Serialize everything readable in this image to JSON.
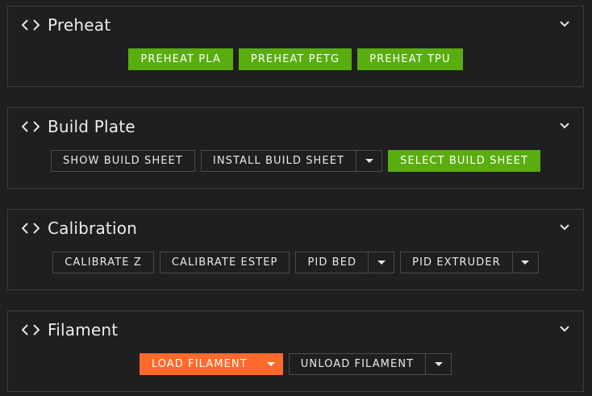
{
  "panels": {
    "preheat": {
      "title": "Preheat",
      "buttons": [
        "PREHEAT PLA",
        "PREHEAT PETG",
        "PREHEAT TPU"
      ]
    },
    "build_plate": {
      "title": "Build Plate",
      "show": "SHOW BUILD SHEET",
      "install": "INSTALL BUILD SHEET",
      "select": "SELECT BUILD SHEET"
    },
    "calibration": {
      "title": "Calibration",
      "calibrate_z": "CALIBRATE Z",
      "calibrate_estep": "CALIBRATE ESTEP",
      "pid_bed": "PID BED",
      "pid_extruder": "PID EXTRUDER"
    },
    "filament": {
      "title": "Filament",
      "load": "LOAD FILAMENT",
      "unload": "UNLOAD FILAMENT"
    }
  },
  "icons": {
    "panel_icon": "code-brackets-icon",
    "collapse": "chevron-down-icon",
    "dropdown": "caret-down-icon"
  },
  "colors": {
    "background": "#1f1f21",
    "border": "#3c3c3f",
    "primary_green": "#5aad0f",
    "accent_orange": "#ff6a2c"
  }
}
